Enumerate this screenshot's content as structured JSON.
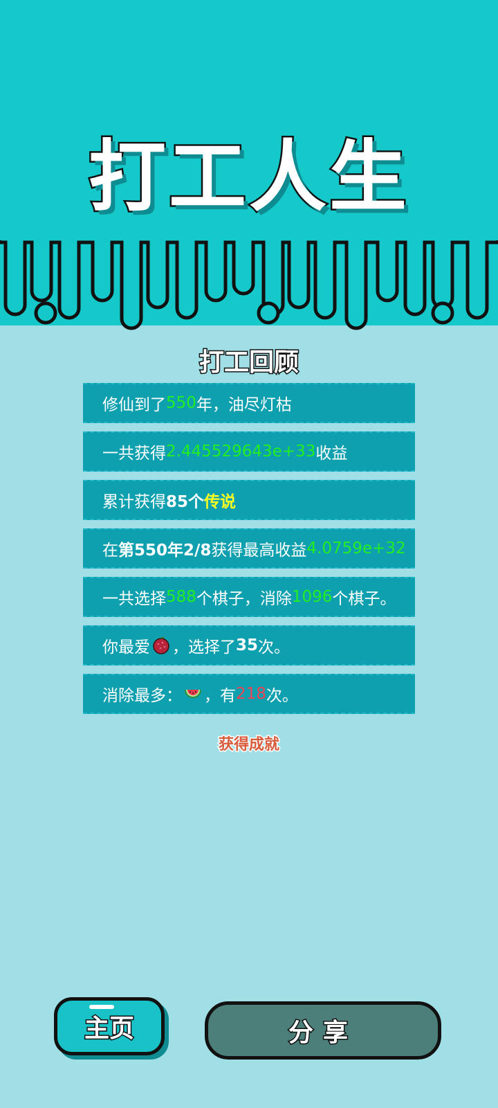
{
  "header": {
    "title": "打工人生"
  },
  "review": {
    "heading": "打工回顾",
    "rows": [
      {
        "a": "修仙到了",
        "b": "550",
        "c": "年，油尽灯枯"
      },
      {
        "a": "一共获得",
        "b": "2.445529643e+33",
        "c": "收益"
      },
      {
        "a": "累计获得",
        "b": "85个",
        "c": "传说"
      },
      {
        "a": "在 ",
        "b": "第550年2/8",
        "c": " 获得最高收益",
        "d": "4.0759e+32"
      },
      {
        "a": "一共选择",
        "b": "588",
        "c": "个棋子，消除",
        "d": "1096",
        "e": "个棋子。"
      },
      {
        "a": "你最爱",
        "b": "，选择了",
        "c": "35",
        "d": "次。"
      },
      {
        "a": "消除最多：",
        "b": "，有",
        "c": "218",
        "d": "次。"
      }
    ],
    "fav_fruit_icon": "lychee-icon",
    "most_cleared_icon": "watermelon-icon"
  },
  "achievement_link": "获得成就",
  "buttons": {
    "home": "主页",
    "share": "分享"
  },
  "colors": {
    "top_bg": "#15c9cb",
    "bottom_bg": "#a0dfe6",
    "row_bg": "#0fa0b0",
    "highlight_green": "#22ee22",
    "highlight_yellow": "#ffff22",
    "highlight_red": "#ee4455",
    "achievement": "#d75c3c",
    "share_button": "#4c7f79"
  }
}
